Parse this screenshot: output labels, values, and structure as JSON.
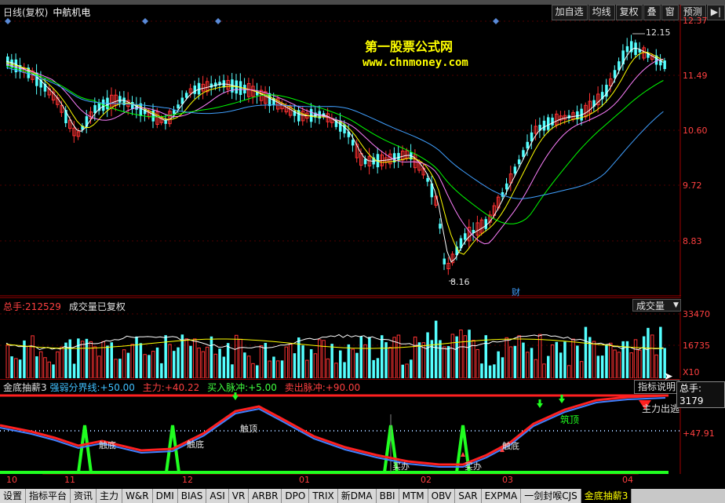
{
  "header": {
    "period": "日线(复权)",
    "stock_name": "中航机电",
    "buttons": [
      "加自选",
      "均线",
      "复权",
      "叠",
      "窗",
      "预测"
    ],
    "nav_arrows": "▶|"
  },
  "watermark": {
    "title": "第一股票公式网",
    "url": "www.chnmoney.com"
  },
  "price_axis": [
    "12.37",
    "11.49",
    "10.60",
    "9.72",
    "8.83"
  ],
  "price_annotations": {
    "high": "12.15",
    "low": "8.16",
    "finance_marker": "财"
  },
  "volume_panel": {
    "total_label": "总手:",
    "total_value": "212529",
    "status": "成交量已复权",
    "selector": "成交量",
    "axis": [
      "33470",
      "16735",
      "X10"
    ]
  },
  "indicator_panel": {
    "name": "金底抽薪3",
    "items": [
      {
        "label": "强弱分界线:",
        "value": "+50.00",
        "color": "#40c0ff"
      },
      {
        "label": "主力:",
        "value": "+40.22",
        "color": "#ff4040"
      },
      {
        "label": "买入脉冲:",
        "value": "+5.00",
        "color": "#40ff40"
      },
      {
        "label": "卖出脉冲:",
        "value": "+90.00",
        "color": "#ff4040"
      }
    ],
    "explain_button": "指标说明",
    "axis_value": "+47.91",
    "annotations": {
      "bottom_1": "触底",
      "bottom_2": "触底",
      "bottom_3": "触底",
      "top_1": "触顶",
      "buy_1": "买办",
      "buy_2": "买办",
      "top_2": "筑顶",
      "escape": "主力出逃"
    }
  },
  "tooltip": "总手: 3179",
  "time_axis": [
    "10",
    "11",
    "12",
    "01",
    "02",
    "03",
    "04"
  ],
  "tabs": [
    "设置",
    "指标平台",
    "资讯",
    "主力",
    "W&R",
    "DMI",
    "BIAS",
    "ASI",
    "VR",
    "ARBR",
    "DPO",
    "TRIX",
    "新DMA",
    "BBI",
    "MTM",
    "OBV",
    "SAR",
    "EXPMA",
    "一剑封喉CJS",
    "金底抽薪3"
  ],
  "active_tab": "金底抽薪3",
  "colors": {
    "up": "#ff3232",
    "down": "#54ffff",
    "ma5": "#ffffff",
    "ma10": "#ffff00",
    "ma20": "#ff80ff",
    "ma30": "#00ff00",
    "ma60": "#40a0ff",
    "grid": "#800000"
  }
}
